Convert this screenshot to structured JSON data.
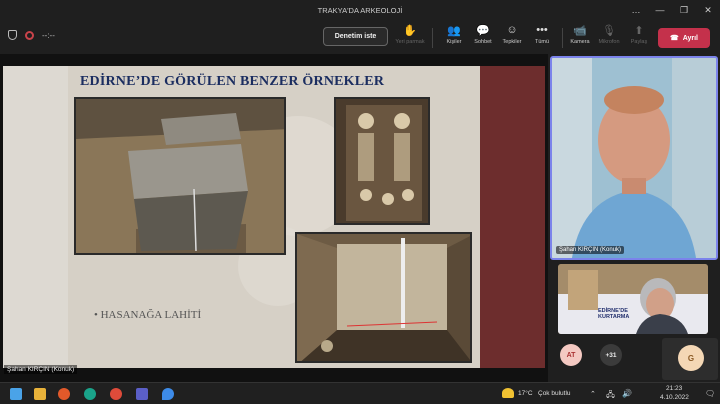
{
  "window": {
    "title": "TRAKYA'DA ARKEOLOJİ"
  },
  "toolbar": {
    "timer": "--:--",
    "request_control": "Denetim iste",
    "raise_hand": "Yeri parmak",
    "people": "Kişiler",
    "chat": "Sohbet",
    "reactions": "Tepkiler",
    "more": "Tümü",
    "camera": "Kamera",
    "mic": "Mikrofon",
    "share": "Paylaş",
    "leave": "Ayrıl"
  },
  "slide": {
    "title": "EDİRNE’DE GÖRÜLEN BENZER ÖRNEKLER",
    "bullet": "• HASANAĞA LAHİTİ"
  },
  "stage": {
    "presenter_label": "Şahan KIRÇIN (Konuk)"
  },
  "participants": {
    "main_label": "Şahan KIRÇIN (Konuk)",
    "second_caption": "EDİRNE’DE\nKURTARMA",
    "avatar_at": "AT",
    "more_count": "+31",
    "avatar_g": "G"
  },
  "taskbar": {
    "temperature": "17°C",
    "weather": "Çok bulutlu",
    "time": "21:23",
    "date": "4.10.2022"
  },
  "colors": {
    "accent": "#7b83eb",
    "leave": "#c4314b",
    "slide_title": "#1b2d60"
  }
}
